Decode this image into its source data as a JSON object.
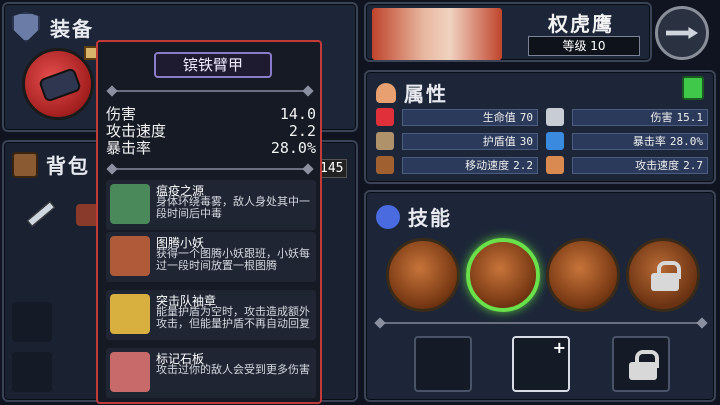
{
  "equipment": {
    "title": "装备"
  },
  "backpack": {
    "title": "背包",
    "count": "145"
  },
  "tooltip": {
    "item_name": "镔铁臂甲",
    "stats": [
      {
        "label": "伤害",
        "value": "14.0"
      },
      {
        "label": "攻击速度",
        "value": "2.2"
      },
      {
        "label": "暴击率",
        "value": "28.0%"
      }
    ],
    "perks": [
      {
        "name": "瘟疫之源",
        "desc": "身体环绕毒雾，敌人身处其中一段时间后中毒"
      },
      {
        "name": "图腾小妖",
        "desc": "获得一个图腾小妖跟班，小妖每过一段时间放置一根图腾"
      },
      {
        "name": "突击队袖章",
        "desc": "能量护盾为空时，攻击造成额外攻击，但能量护盾不再自动回复"
      },
      {
        "name": "标记石板",
        "desc": "攻击过你的敌人会受到更多伤害"
      }
    ]
  },
  "character": {
    "name": "权虎鹰",
    "level": "等级 10"
  },
  "attributes": {
    "title": "属性",
    "stats": [
      {
        "label": "生命值",
        "value": "70",
        "icon": "heart-icon",
        "color": "#e0303a"
      },
      {
        "label": "伤害",
        "value": "15.1",
        "icon": "sword-icon",
        "color": "#c8ccd4"
      },
      {
        "label": "护盾值",
        "value": "30",
        "icon": "shield-icon",
        "color": "#b0926a"
      },
      {
        "label": "暴击率",
        "value": "28.0%",
        "icon": "eye-icon",
        "color": "#3a8ae0"
      },
      {
        "label": "移动速度",
        "value": "2.2",
        "icon": "boot-icon",
        "color": "#a06030"
      },
      {
        "label": "攻击速度",
        "value": "2.7",
        "icon": "fist-icon",
        "color": "#d88a50"
      }
    ]
  },
  "skills": {
    "title": "技能"
  }
}
